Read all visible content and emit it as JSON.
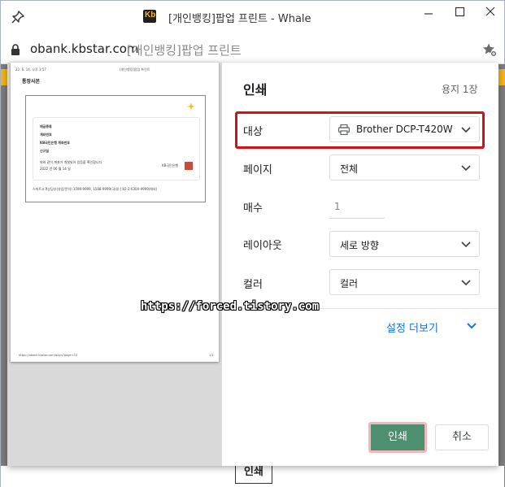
{
  "window": {
    "title": "[개인뱅킹]팝업 프린트 - Whale",
    "app_logo_text": "Kb"
  },
  "address": {
    "url": "obank.kbstar.com",
    "page_title": "[개인뱅킹]팝업 프린트"
  },
  "dialog": {
    "title": "인쇄",
    "sheet_count": "용지 1장",
    "rows": {
      "destination": {
        "label": "대상",
        "value": "Brother DCP-T420W"
      },
      "pages": {
        "label": "페이지",
        "value": "전체"
      },
      "copies": {
        "label": "매수",
        "value": "1"
      },
      "layout": {
        "label": "레이아웃",
        "value": "세로 방향"
      },
      "color": {
        "label": "컬러",
        "value": "컬러"
      }
    },
    "more_settings": "설정 더보기",
    "print_button": "인쇄",
    "cancel_button": "취소"
  },
  "preview": {
    "doc_title": "통장사본",
    "lines": [
      "예금종류",
      "계좌번호",
      "KB국민은행 계좌번호",
      "신규일"
    ],
    "confirm_text": "위와 같이 계좌가 개설되어 있음을 확인합니다",
    "date_text": "2022 년 06 월 14 일",
    "bank_label": "KB국민은행"
  },
  "page": {
    "print_button": "인쇄"
  },
  "watermark": "https://forced.tistory.com",
  "colors": {
    "accent_blue": "#1a73e8",
    "print_green": "#4d8f6e",
    "highlight_red": "#d0121b",
    "kb_yellow": "#f2b51b"
  }
}
